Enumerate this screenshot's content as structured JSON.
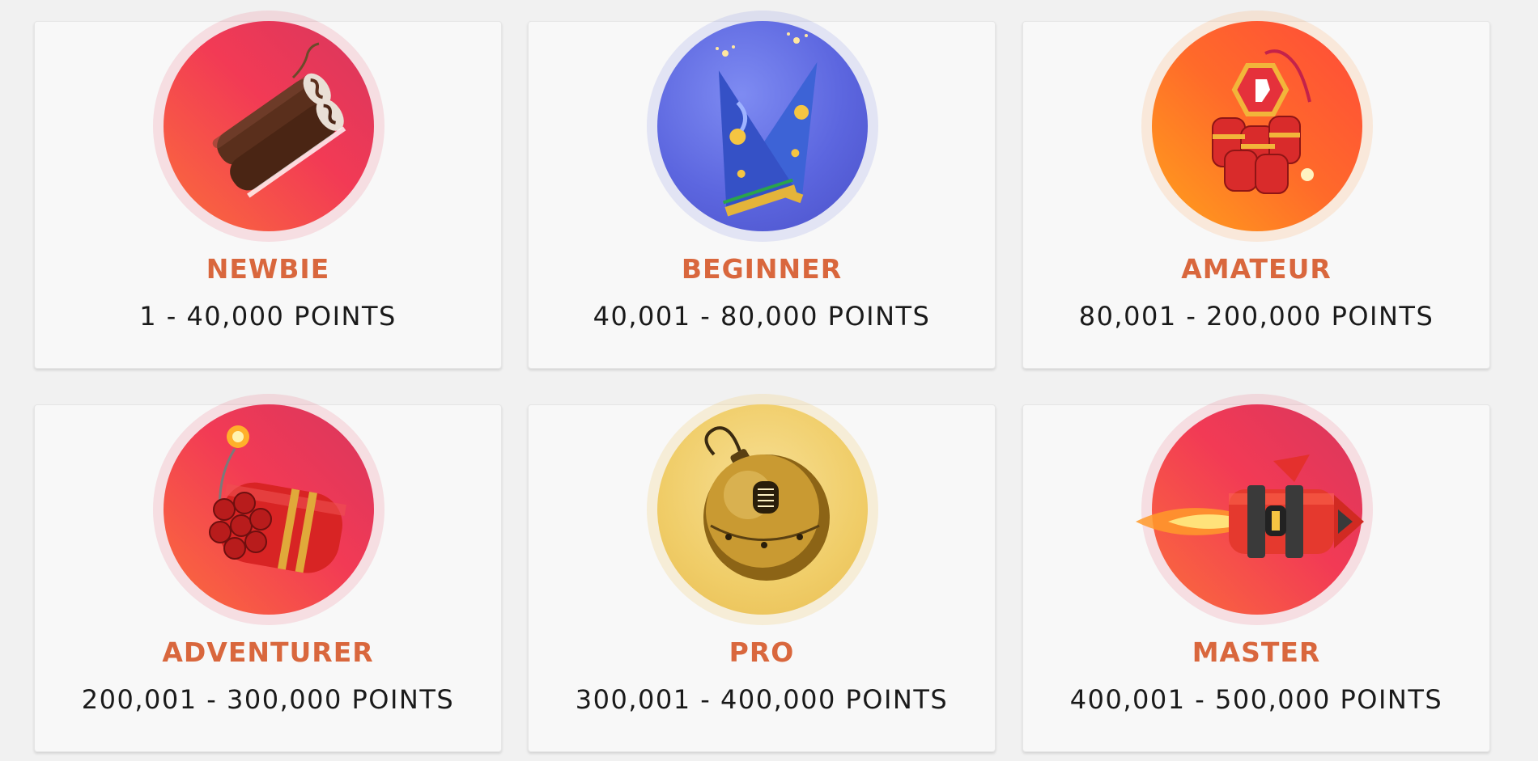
{
  "ranks": [
    {
      "title": "NEWBIE",
      "points": "1 - 40,000 POINTS",
      "icon": "chocolate-roll-firecracker-icon",
      "theme": "#ec3f5c"
    },
    {
      "title": "BEGINNER",
      "points": "40,001 - 80,000 POINTS",
      "icon": "party-hats-sparkler-icon",
      "theme": "#5f68e0"
    },
    {
      "title": "AMATEUR",
      "points": "80,001 - 200,000 POINTS",
      "icon": "firecracker-bundle-icon",
      "theme": "#ff7a22"
    },
    {
      "title": "ADVENTURER",
      "points": "200,001 - 300,000 POINTS",
      "icon": "dynamite-bundle-icon",
      "theme": "#ec3f5c"
    },
    {
      "title": "PRO",
      "points": "300,001 - 400,000 POINTS",
      "icon": "golden-bomb-icon",
      "theme": "#f0cd68"
    },
    {
      "title": "MASTER",
      "points": "400,001 - 500,000 POINTS",
      "icon": "rocket-icon",
      "theme": "#ec3f5c"
    }
  ],
  "colors": {
    "title": "#d9673d",
    "points_text": "#1a1a1a",
    "card_bg": "#f8f8f8",
    "page_bg": "#f1f1f1"
  }
}
